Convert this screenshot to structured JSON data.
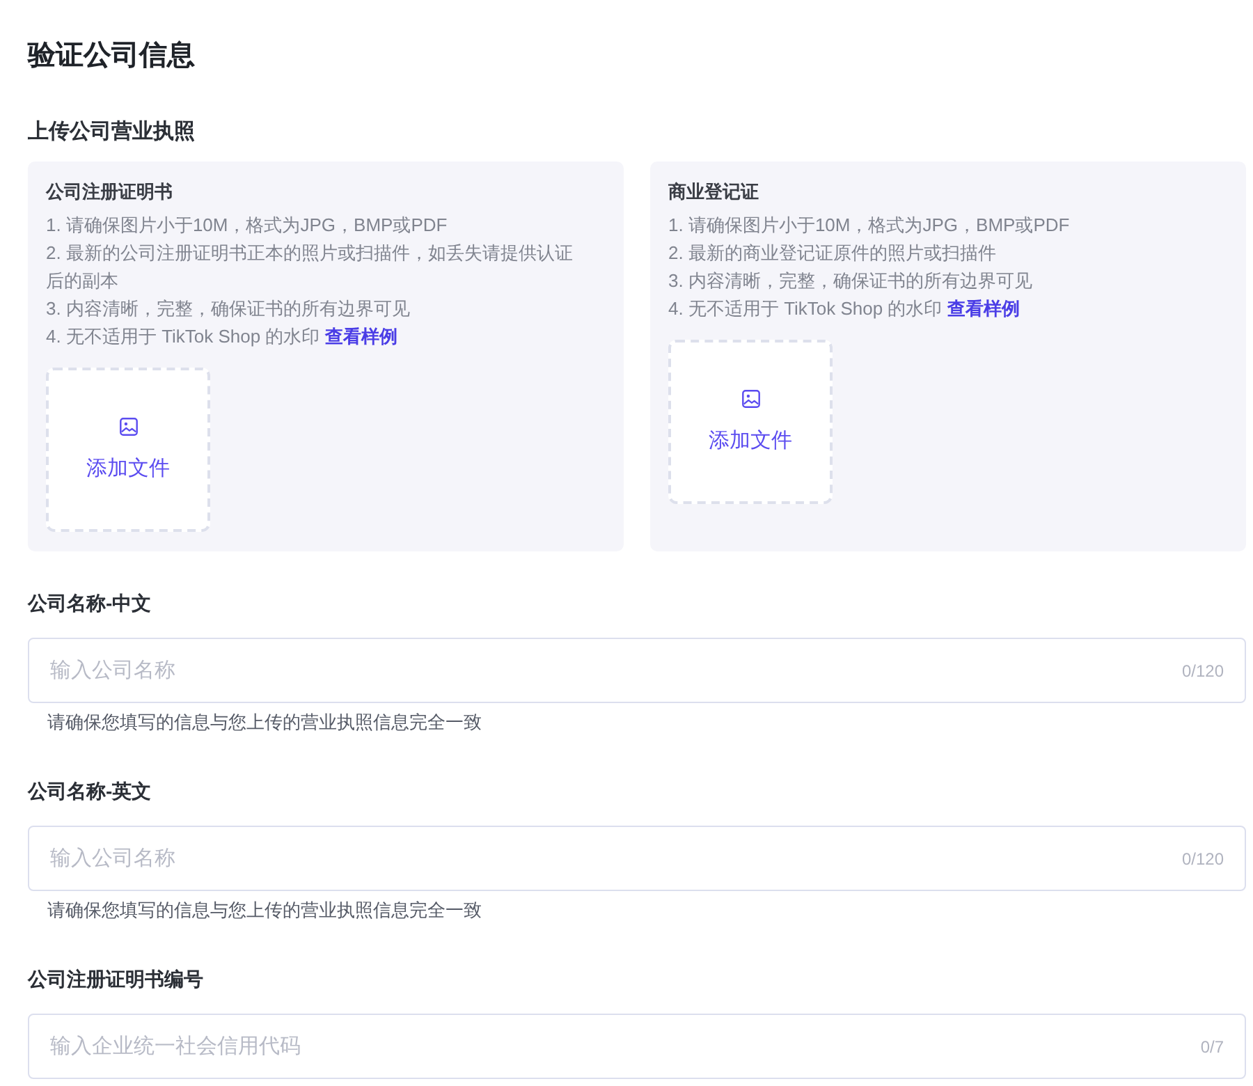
{
  "page_title": "验证公司信息",
  "upload_section": {
    "title": "上传公司营业执照",
    "cards": [
      {
        "title": "公司注册证明书",
        "instructions": [
          "1. 请确保图片小于10M，格式为JPG，BMP或PDF",
          "2. 最新的公司注册证明书正本的照片或扫描件，如丢失请提供认证后的副本",
          "3. 内容清晰，完整，确保证书的所有边界可见",
          "4. 无不适用于 TikTok Shop 的水印"
        ],
        "link": "查看样例",
        "upload_label": "添加文件"
      },
      {
        "title": "商业登记证",
        "instructions": [
          "1. 请确保图片小于10M，格式为JPG，BMP或PDF",
          "2. 最新的商业登记证原件的照片或扫描件",
          "3. 内容清晰，完整，确保证书的所有边界可见",
          "4. 无不适用于 TikTok Shop 的水印"
        ],
        "link": "查看样例",
        "upload_label": "添加文件"
      }
    ]
  },
  "fields": [
    {
      "label": "公司名称-中文",
      "placeholder": "输入公司名称",
      "counter": "0/120",
      "help": "请确保您填写的信息与您上传的营业执照信息完全一致"
    },
    {
      "label": "公司名称-英文",
      "placeholder": "输入公司名称",
      "counter": "0/120",
      "help": "请确保您填写的信息与您上传的营业执照信息完全一致"
    },
    {
      "label": "公司注册证明书编号",
      "placeholder": "输入企业统一社会信用代码",
      "counter": "0/7"
    }
  ]
}
